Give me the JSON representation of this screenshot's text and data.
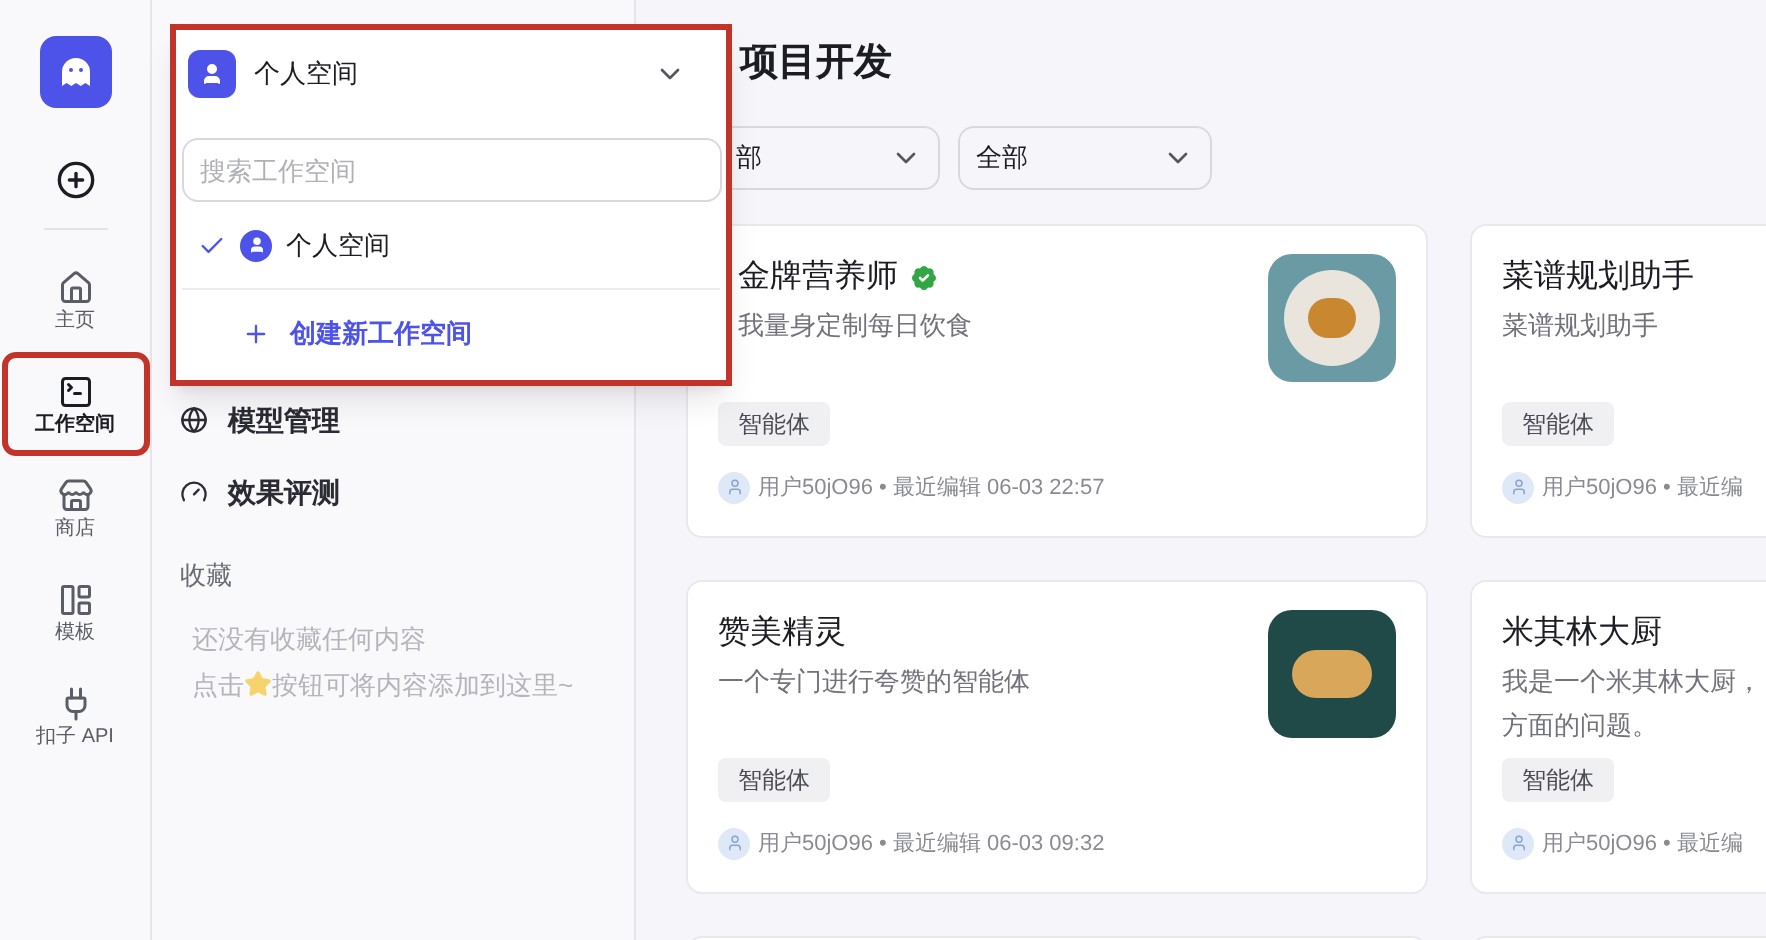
{
  "rail": {
    "items": [
      {
        "label": "主页",
        "selected": false
      },
      {
        "label": "工作空间",
        "selected": true
      },
      {
        "label": "商店",
        "selected": false
      },
      {
        "label": "模板",
        "selected": false
      },
      {
        "label": "扣子 API",
        "selected": false
      }
    ]
  },
  "panel": {
    "items": [
      {
        "label": "模型管理"
      },
      {
        "label": "效果评测"
      }
    ],
    "favorites": {
      "title": "收藏",
      "empty_line": "还没有收藏任何内容",
      "hint_before": "点击",
      "hint_after": "按钮可将内容添加到这里~"
    }
  },
  "workspace_menu": {
    "current": "个人空间",
    "search": {
      "placeholder": "搜索工作空间"
    },
    "options": [
      {
        "label": "个人空间",
        "selected": true
      }
    ],
    "create": "创建新工作空间"
  },
  "main": {
    "title": "项目开发",
    "filters": [
      "部",
      "全部"
    ],
    "cards": [
      {
        "title": "金牌营养师",
        "verified": true,
        "description": [
          "我量身定制每日饮食"
        ],
        "tag": "智能体",
        "meta": "用户50jO96 • 最近编辑 06-03 22:57"
      },
      {
        "title": "菜谱规划助手",
        "verified": false,
        "description": [
          "菜谱规划助手"
        ],
        "tag": "智能体",
        "meta": "用户50jO96 • 最近编"
      },
      {
        "title": "赞美精灵",
        "verified": false,
        "description": [
          "一个专门进行夸赞的智能体"
        ],
        "tag": "智能体",
        "meta": "用户50jO96 • 最近编辑 06-03 09:32"
      },
      {
        "title": "米其林大厨",
        "verified": false,
        "description": [
          "我是一个米其林大厨，",
          "方面的问题。"
        ],
        "tag": "智能体",
        "meta": "用户50jO96 • 最近编"
      }
    ]
  }
}
